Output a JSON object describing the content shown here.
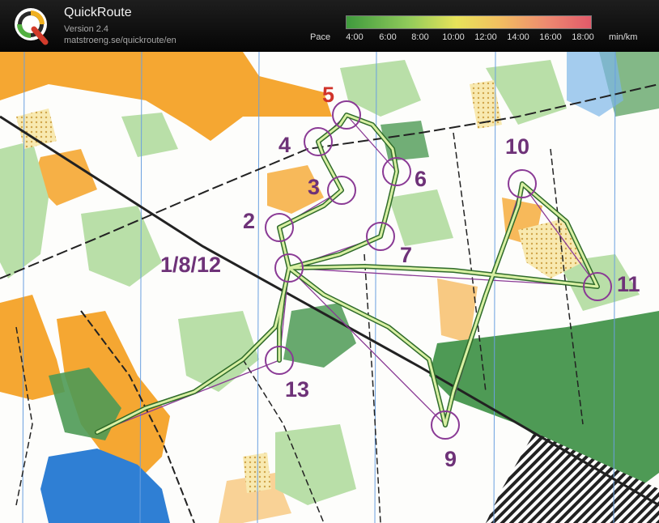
{
  "app": {
    "title": "QuickRoute",
    "version": "Version 2.4",
    "url": "matstroeng.se/quickroute/en"
  },
  "pace_scale": {
    "label": "Pace",
    "ticks": [
      "4:00",
      "6:00",
      "8:00",
      "10:00",
      "12:00",
      "14:00",
      "16:00",
      "18:00"
    ],
    "unit": "min/km"
  },
  "map": {
    "controls": [
      {
        "label": "1/8/12"
      },
      {
        "label": "2"
      },
      {
        "label": "3"
      },
      {
        "label": "4"
      },
      {
        "label": "5"
      },
      {
        "label": "6"
      },
      {
        "label": "7"
      },
      {
        "label": "9"
      },
      {
        "label": "10"
      },
      {
        "label": "11"
      },
      {
        "label": "13"
      }
    ]
  },
  "colors": {
    "control_purple": "#6e3278",
    "open_land": "#f5a732",
    "forest_green": "#4e9a55",
    "light_green": "#b9dfa8",
    "water": "#2f7fd4",
    "route_light": "#d9f0a3",
    "route_dark": "#2f6b2a",
    "north_lines": "#6aa0e0"
  }
}
